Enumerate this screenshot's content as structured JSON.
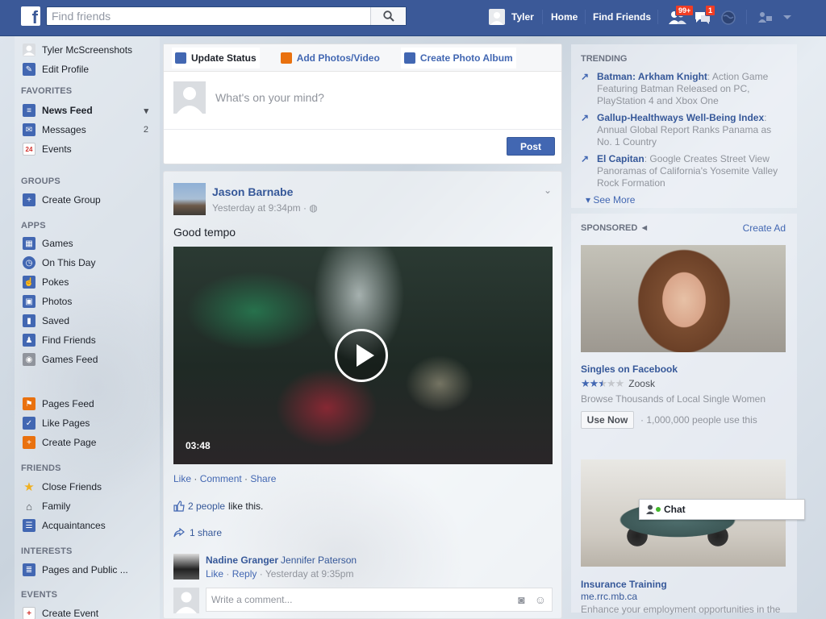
{
  "header": {
    "search_placeholder": "Find friends",
    "user_name": "Tyler",
    "home_label": "Home",
    "find_friends_label": "Find Friends",
    "friend_requests_count": "99+",
    "messages_count": "1"
  },
  "sidebar": {
    "profile_name": "Tyler McScreenshots",
    "edit_profile": "Edit Profile",
    "favorites_head": "FAVORITES",
    "favorites": [
      {
        "label": "News Feed",
        "count": ""
      },
      {
        "label": "Messages",
        "count": "2"
      },
      {
        "label": "Events",
        "count": ""
      }
    ],
    "groups_head": "GROUPS",
    "groups": [
      {
        "label": "Create Group"
      }
    ],
    "apps_head": "APPS",
    "apps": [
      {
        "label": "Games"
      },
      {
        "label": "On This Day"
      },
      {
        "label": "Pokes"
      },
      {
        "label": "Photos"
      },
      {
        "label": "Saved"
      },
      {
        "label": "Find Friends"
      },
      {
        "label": "Games Feed"
      },
      {
        "label": "Pages Feed"
      },
      {
        "label": "Like Pages"
      },
      {
        "label": "Create Page"
      }
    ],
    "friends_head": "FRIENDS",
    "friends": [
      {
        "label": "Close Friends"
      },
      {
        "label": "Family"
      },
      {
        "label": "Acquaintances"
      }
    ],
    "interests_head": "INTERESTS",
    "interests": [
      {
        "label": "Pages and Public ..."
      }
    ],
    "events_head": "EVENTS",
    "events": [
      {
        "label": "Create Event"
      }
    ],
    "events_date_icon": "24"
  },
  "composer": {
    "tabs": [
      "Update Status",
      "Add Photos/Video",
      "Create Photo Album"
    ],
    "prompt": "What's on your mind?",
    "post_label": "Post"
  },
  "post": {
    "author": "Jason Barnabe",
    "time": "Yesterday at 9:34pm · ",
    "text": "Good tempo",
    "duration": "03:48",
    "actions": [
      "Like",
      "Comment",
      "Share"
    ],
    "likes_link": "2 people",
    "likes_suffix": "like this.",
    "shares": "1 share",
    "comment": {
      "author": "Nadine Granger",
      "text": "Jennifer Paterson",
      "like": "Like",
      "reply": "Reply",
      "time": "Yesterday at 9:35pm"
    },
    "write_placeholder": "Write a comment..."
  },
  "trending": {
    "head": "TRENDING",
    "items": [
      {
        "title": "Batman: Arkham Knight",
        "desc": ": Action Game Featuring Batman Released on PC, PlayStation 4 and Xbox One"
      },
      {
        "title": "Gallup-Healthways Well-Being Index",
        "desc": ": Annual Global Report Ranks Panama as No. 1 Country"
      },
      {
        "title": "El Capitan",
        "desc": ": Google Creates Street View Panoramas of California's Yosemite Valley Rock Formation"
      }
    ],
    "see_more": "See More"
  },
  "sponsored": {
    "head": "SPONSORED",
    "create_ad": "Create Ad",
    "ad1": {
      "title": "Singles on Facebook",
      "advertiser": "Zoosk",
      "rating": 2.5,
      "desc": "Browse Thousands of Local Single Women",
      "cta": "Use Now",
      "count": "· 1,000,000 people use this"
    },
    "ad2": {
      "title": "Insurance Training",
      "url": "me.rrc.mb.ca",
      "desc": "Enhance your employment opportunities in the"
    }
  },
  "chat": {
    "label": "Chat"
  }
}
